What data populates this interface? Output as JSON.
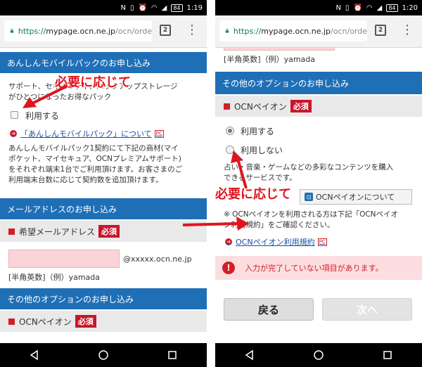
{
  "status": {
    "left_time": "1:19",
    "right_time": "1:20",
    "battery": "84"
  },
  "browser": {
    "url_scheme": "https://",
    "url_host": "mypage.ocn.ne.jp",
    "url_path": "/ocn/orde",
    "tab_count": "2"
  },
  "left": {
    "anshin_header": "あんしんモバイルパックのお申し込み",
    "anshin_desc_line1": "サポート、セキュリティ、バックアップストレージ",
    "anshin_desc_line2": "がひとつになったお得なパック",
    "anshin_checkbox_label": "利用する",
    "anshin_link": "「あんしんモバイルパック」について",
    "pc_badge": "PC",
    "anshin_body_1": "あんしんモバイルパック1契約にて下記の商材(マイ",
    "anshin_body_2": "ポケット、マイセキュア、OCNプレミアムサポート)",
    "anshin_body_3": "をそれぞれ端末1台でご利用頂けます。お客さまのご",
    "anshin_body_4": "利用端末台数に応じて契約数を追加頂けます。",
    "mail_header": "メールアドレスのお申し込み",
    "mail_field_label": "希望メールアドレス",
    "required": "必須",
    "mail_domain": "@xxxxx.ocn.ne.jp",
    "mail_hint": "[半角英数]（例）yamada",
    "option_header": "その他のオプションのお申し込み",
    "ocn_payon_label": "OCNペイオン",
    "annotation": "必要に応じて"
  },
  "right": {
    "top_hint": "[半角英数]（例）yamada",
    "option_header": "その他のオプションのお申し込み",
    "ocn_payon_label": "OCNペイオン",
    "required": "必須",
    "radio_use": "利用する",
    "radio_not_use": "利用しない",
    "desc_line1": "占い・音楽・ゲームなどの多彩なコンテンツを購入",
    "desc_line2": "できるサービスです。",
    "info_button": "OCNペイオンについて",
    "notice_line1": "※ OCNペイオンを利用される方は下記「OCNペイオ",
    "notice_line2": "ン利用規約」をご確認ください。",
    "terms_link": "OCNペイオン利用規約",
    "pc_badge": "PC",
    "error_message": "入力が完了していない項目があります。",
    "back_button": "戻る",
    "next_button": "次へ",
    "annotation": "必要に応じて"
  },
  "colors": {
    "header_blue": "#1f6fb7",
    "required_red": "#c7162b",
    "annotation_red": "#e0141e",
    "error_bg": "#fcdde0",
    "input_pink": "#fbd4d8"
  }
}
